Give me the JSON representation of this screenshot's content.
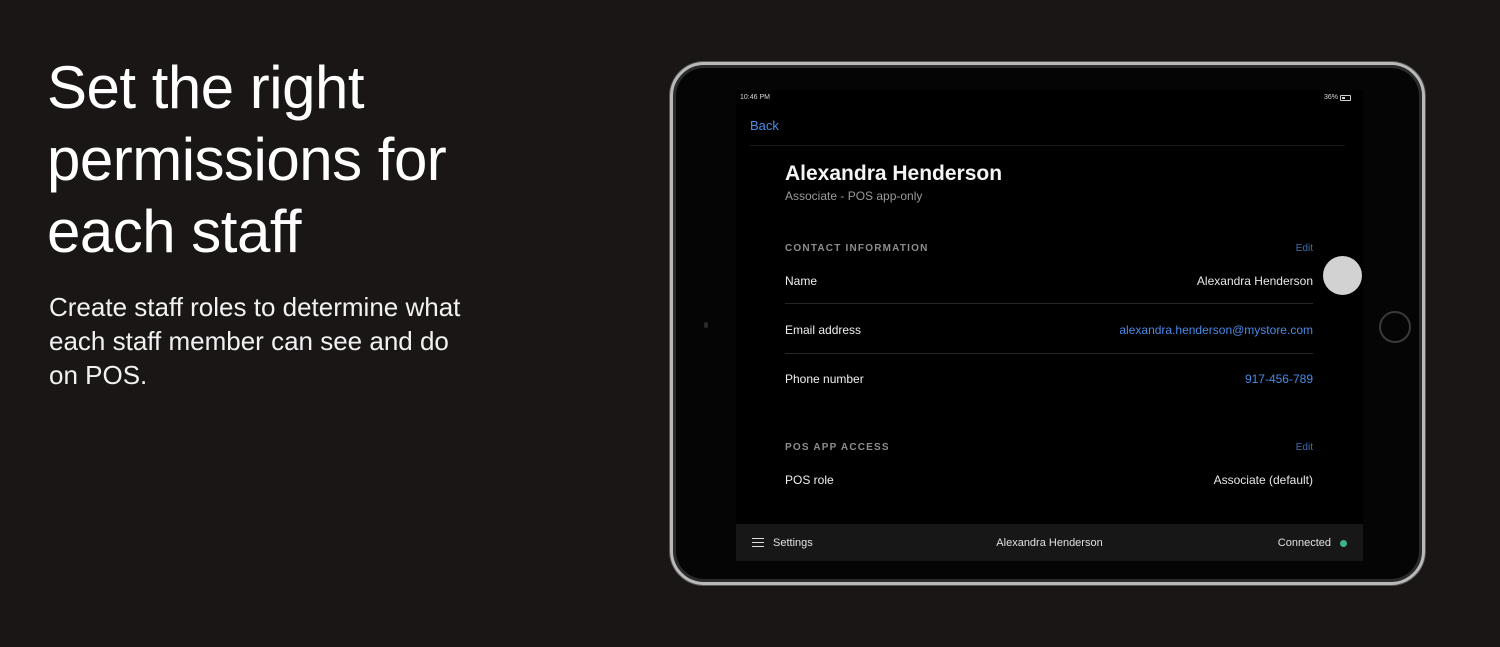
{
  "hero": {
    "headline": "Set the right permissions for each staff",
    "subtext": "Create staff roles to determine what each staff member can see and do on POS."
  },
  "status_bar": {
    "time": "10:46 PM",
    "battery": "36%"
  },
  "nav": {
    "back_label": "Back"
  },
  "profile": {
    "name": "Alexandra Henderson",
    "subtitle": "Associate - POS app-only"
  },
  "contact_section": {
    "header": "CONTACT INFORMATION",
    "edit_label": "Edit",
    "rows": [
      {
        "label": "Name",
        "value": "Alexandra Henderson"
      },
      {
        "label": "Email address",
        "value": "alexandra.henderson@mystore.com"
      },
      {
        "label": "Phone number",
        "value": "917-456-789"
      }
    ]
  },
  "pos_section": {
    "header": "POS APP ACCESS",
    "edit_label": "Edit",
    "rows": [
      {
        "label": "POS role",
        "value": "Associate (default)"
      }
    ]
  },
  "bottom_bar": {
    "settings_label": "Settings",
    "user_name": "Alexandra Henderson",
    "connection_status": "Connected",
    "status_color": "#3fb28a"
  },
  "colors": {
    "background": "#1b1616",
    "link": "#4a8ae6"
  }
}
